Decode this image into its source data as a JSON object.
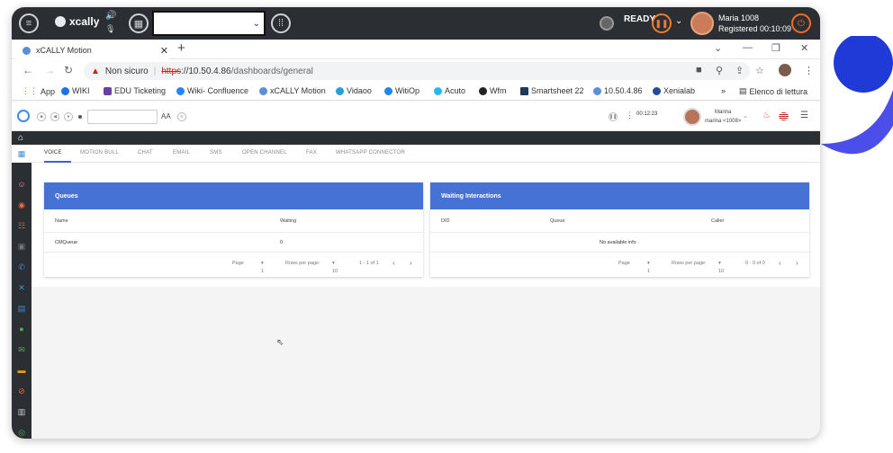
{
  "softphone": {
    "logo_text": "xcally",
    "status": "READY",
    "user_name": "Maria 1008",
    "registered": "Registered 00:10:09"
  },
  "browser": {
    "tab_title": "xCALLY Motion",
    "url_warning": "Non sicuro",
    "url_protocol": "https",
    "url_host": "://10.50.4.86",
    "url_path": "/dashboards/general",
    "bookmarks": [
      {
        "label": "App",
        "color": "#4285f4"
      },
      {
        "label": "WIKI",
        "color": "#1a73e8"
      },
      {
        "label": "EDU Ticketing",
        "color": "#6b3fa0"
      },
      {
        "label": "Wiki- Confluence",
        "color": "#2684ff"
      },
      {
        "label": "xCALLY Motion",
        "color": "#5a8fd8"
      },
      {
        "label": "Vidaoo",
        "color": "#27a0d8"
      },
      {
        "label": "WitiOp",
        "color": "#1e88e5"
      },
      {
        "label": "Acuto",
        "color": "#29b6f6"
      },
      {
        "label": "Wfm",
        "color": "#222222"
      },
      {
        "label": "Smartsheet 22",
        "color": "#1f3a56"
      },
      {
        "label": "10.50.4.86",
        "color": "#5a8fd8"
      },
      {
        "label": "Xenialab",
        "color": "#1e4e9c"
      }
    ],
    "more": "»",
    "reading_list": "Elenco di lettura"
  },
  "appheader": {
    "font_label": "AA",
    "timer": "00:12:23",
    "user_name": "Marina",
    "user_ext": "marina <1008>"
  },
  "tabs": [
    "VOICE",
    "MOTION BULL",
    "CHAT",
    "EMAIL",
    "SMS",
    "OPEN CHANNEL",
    "FAX",
    "WHATSAPP CONNECTOR"
  ],
  "queues": {
    "title": "Queues",
    "col_name": "Name",
    "col_waiting": "Waiting",
    "row_name": "CMQueue",
    "row_waiting": "0",
    "page_label": "Page",
    "page_value": "1",
    "rows_label": "Rows per page:",
    "rows_value": "10",
    "range": "1 - 1 of 1"
  },
  "waiting": {
    "title": "Waiting Interactions",
    "col_did": "DID",
    "col_queue": "Queue",
    "col_caller": "Caller",
    "empty": "No available info",
    "page_label": "Page",
    "page_value": "1",
    "rows_label": "Rows per page:",
    "rows_value": "10",
    "range": "0 - 0 of 0"
  },
  "colors": {
    "accent": "#4672d6",
    "dark_bar": "#2b2f33",
    "orange": "#f17a2f"
  }
}
